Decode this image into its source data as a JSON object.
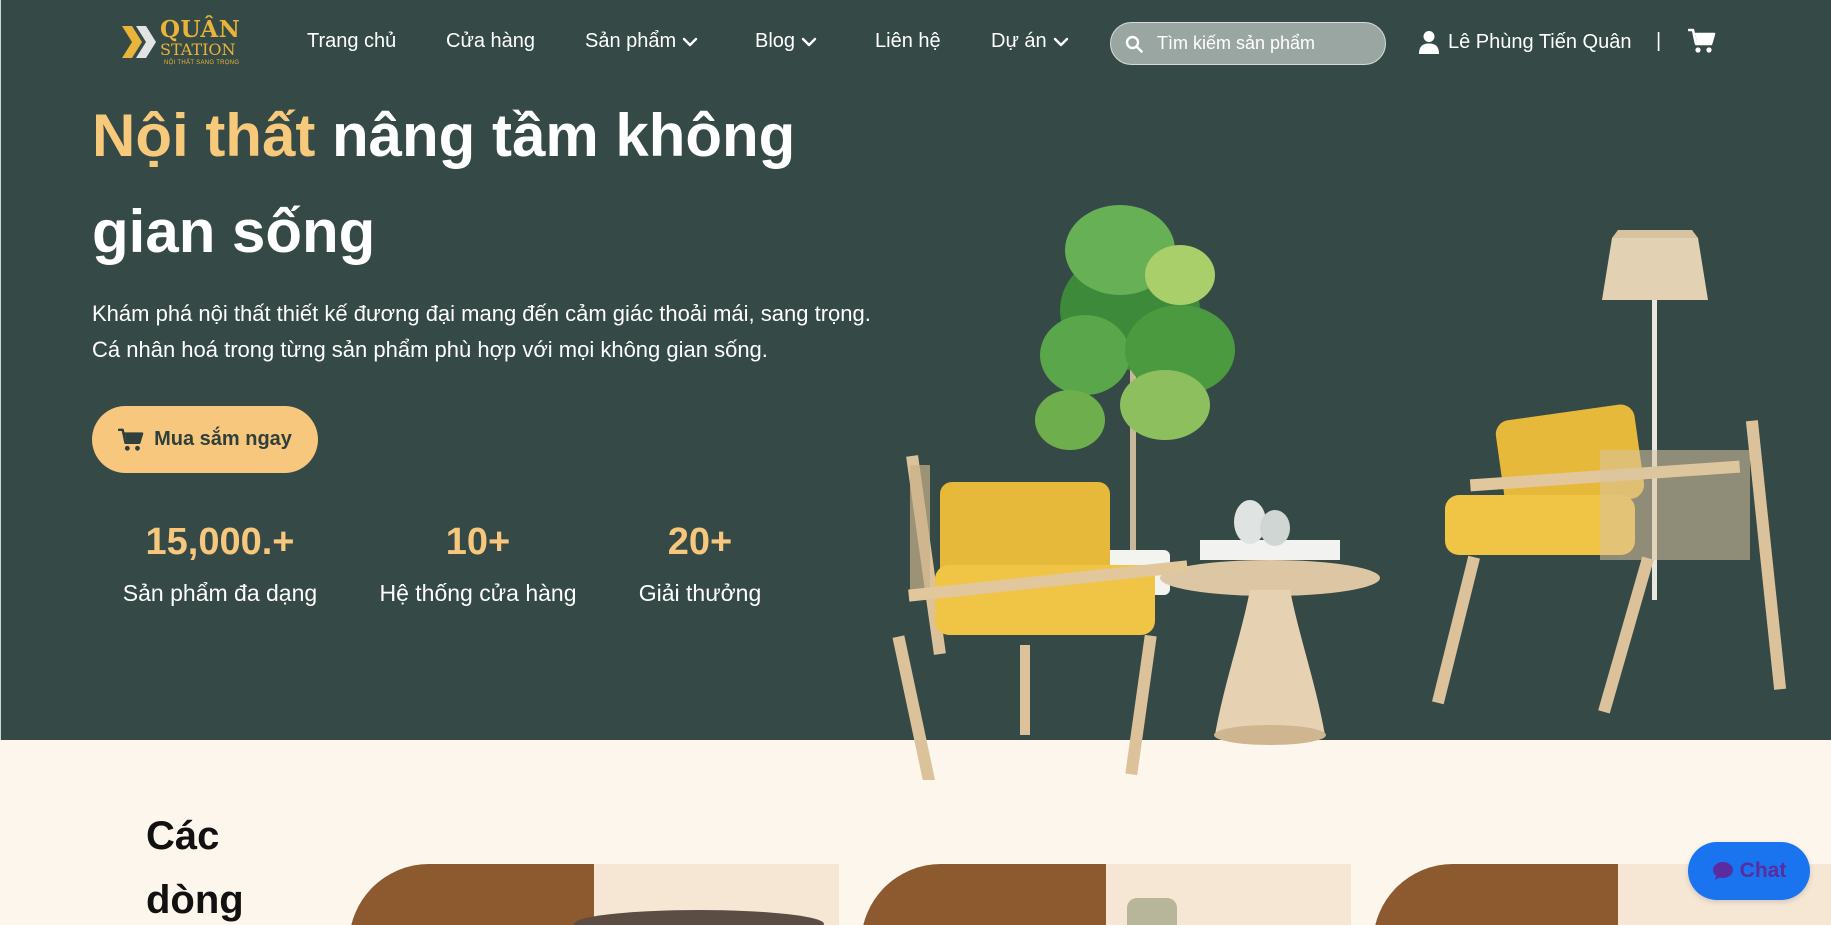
{
  "logo": {
    "line1": "QUÂN",
    "line2": "STATION",
    "tagline": "NỘI THẤT SANG TRỌNG"
  },
  "nav": {
    "items": [
      {
        "label": "Trang chủ",
        "dropdown": false
      },
      {
        "label": "Cửa hàng",
        "dropdown": false
      },
      {
        "label": "Sản phẩm",
        "dropdown": true
      },
      {
        "label": "Blog",
        "dropdown": true
      },
      {
        "label": "Liên hệ",
        "dropdown": false
      },
      {
        "label": "Dự án",
        "dropdown": true
      }
    ],
    "search_placeholder": "Tìm kiếm sản phẩm",
    "user_name": "Lê Phùng Tiến Quân",
    "separator": "|"
  },
  "hero": {
    "headline_accent": "Nội thất",
    "headline_rest": "nâng tầm không gian sống",
    "description_line1": "Khám phá nội thất thiết kế đương đại mang đến cảm giác thoải mái, sang trọng.",
    "description_line2": "Cá nhân hoá trong từng sản phẩm phù hợp với mọi không gian sống.",
    "cta_label": "Mua sắm ngay",
    "stats": [
      {
        "value": "15,000.+",
        "label": "Sản phẩm đa dạng"
      },
      {
        "value": "10+",
        "label": "Hệ thống cửa hàng"
      },
      {
        "value": "20+",
        "label": "Giải thưởng"
      }
    ]
  },
  "section": {
    "title": "Các dòng"
  },
  "chat": {
    "label": "Chat"
  },
  "colors": {
    "hero_bg": "#354a46",
    "accent": "#f6c77c",
    "page_bg": "#fdf6ec",
    "card_brown": "#8c5a2e",
    "chat_blue": "#1a74f0"
  }
}
